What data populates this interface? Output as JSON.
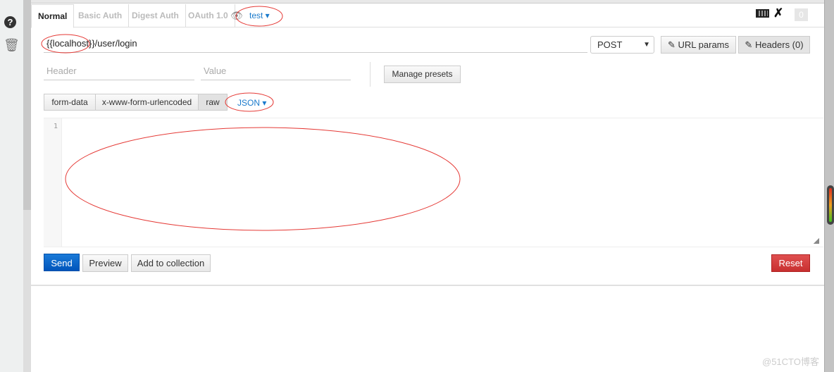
{
  "sidebar": {
    "help_icon": "?",
    "trash_icon": "trash"
  },
  "tabs": [
    {
      "label": "Normal",
      "active": true
    },
    {
      "label": "Basic Auth"
    },
    {
      "label": "Digest Auth"
    },
    {
      "label": "OAuth 1.0"
    }
  ],
  "environment": {
    "label": "test ▾"
  },
  "toolbar": {
    "badge_count": "0"
  },
  "request": {
    "url": "{{localhost}}/user/login",
    "method": "POST",
    "url_params_label": "URL params",
    "headers_label": "Headers (0)"
  },
  "headers_editor": {
    "header_placeholder": "Header",
    "value_placeholder": "Value",
    "manage_presets_label": "Manage presets"
  },
  "body": {
    "modes": [
      "form-data",
      "x-www-form-urlencoded",
      "raw"
    ],
    "active_mode": "raw",
    "format": "JSON ▾",
    "line_numbers": [
      "1"
    ]
  },
  "actions": {
    "send": "Send",
    "preview": "Preview",
    "add_to_collection": "Add to collection",
    "reset": "Reset"
  },
  "watermark": "@51CTO博客",
  "colors": {
    "accent": "#1a7acc",
    "send": "#0055bb",
    "reset": "#cc3333",
    "annotation": "#e53935"
  }
}
